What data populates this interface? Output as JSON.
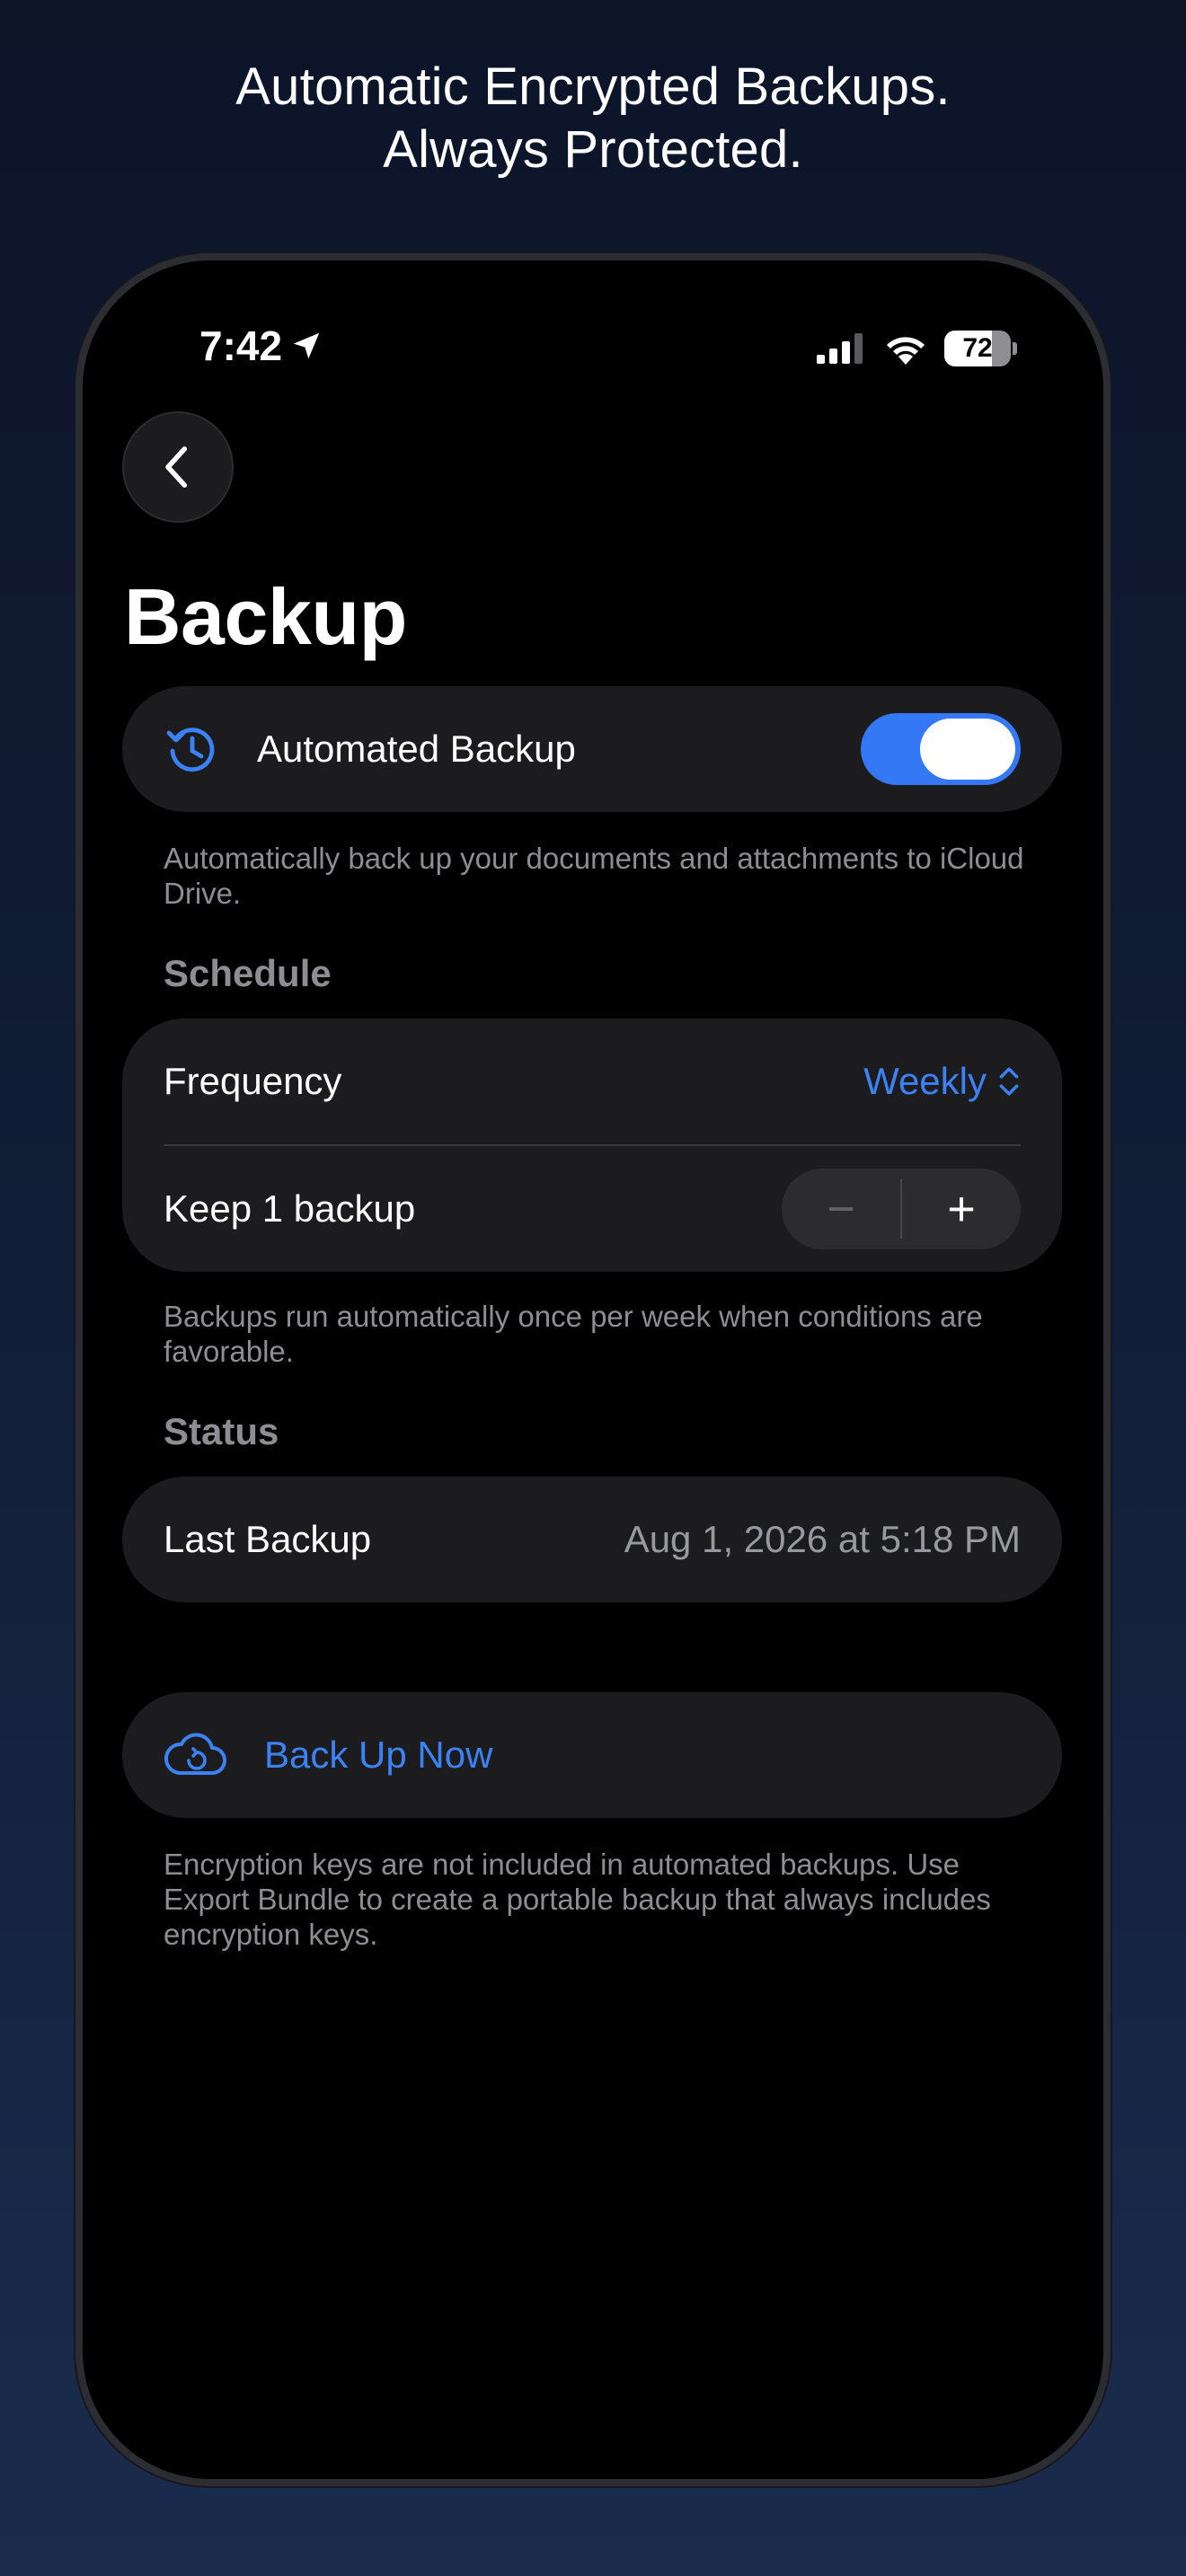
{
  "headline": {
    "line1": "Automatic Encrypted Backups.",
    "line2": "Always Protected."
  },
  "status_bar": {
    "time": "7:42",
    "battery": "72",
    "icons": [
      "location-arrow-icon",
      "cellular-signal-icon",
      "wifi-icon",
      "battery-icon"
    ]
  },
  "nav": {
    "back_icon": "chevron-left-icon"
  },
  "page": {
    "title": "Backup"
  },
  "automated_backup": {
    "label": "Automated Backup",
    "icon": "clock-history-icon",
    "enabled": true,
    "footnote": "Automatically back up your documents and attachments to iCloud Drive."
  },
  "schedule": {
    "header": "Schedule",
    "frequency_label": "Frequency",
    "frequency_value": "Weekly",
    "keep_label": "Keep 1 backup",
    "decrement": "−",
    "increment": "+",
    "footnote": "Backups run automatically once per week when conditions are favorable."
  },
  "status": {
    "header": "Status",
    "last_backup_label": "Last Backup",
    "last_backup_value": "Aug 1, 2026 at 5:18 PM"
  },
  "action": {
    "label": "Back Up Now",
    "icon": "cloud-refresh-icon",
    "footnote": "Encryption keys are not included in automated backups. Use Export Bundle to create a portable backup that always includes encryption keys."
  },
  "colors": {
    "accent": "#3478f6",
    "card": "#1c1c1e",
    "secondary_text": "#8d8d93"
  }
}
